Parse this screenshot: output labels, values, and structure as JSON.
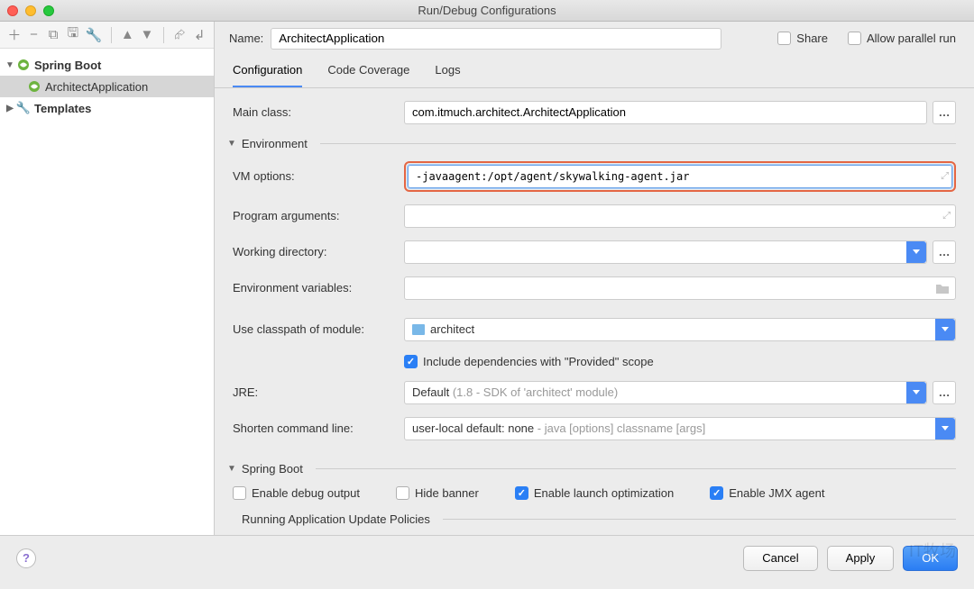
{
  "window": {
    "title": "Run/Debug Configurations"
  },
  "toolbar_icons": [
    "+",
    "−",
    "❐",
    "▤",
    "🔧",
    "▲",
    "▼",
    "⮓",
    "↲"
  ],
  "sidebar": {
    "items": [
      {
        "label": "Spring Boot",
        "level": 0,
        "expanded": true,
        "icon": "spring"
      },
      {
        "label": "ArchitectApplication",
        "level": 1,
        "selected": true,
        "icon": "spring"
      },
      {
        "label": "Templates",
        "level": 0,
        "expanded": false,
        "icon": "wrench"
      }
    ]
  },
  "header": {
    "name_label": "Name:",
    "name_value": "ArchitectApplication",
    "share_label": "Share",
    "allow_parallel_label": "Allow parallel run"
  },
  "tabs": [
    {
      "label": "Configuration",
      "active": true
    },
    {
      "label": "Code Coverage",
      "active": false
    },
    {
      "label": "Logs",
      "active": false
    }
  ],
  "form": {
    "main_class_label": "Main class:",
    "main_class_value": "com.itmuch.architect.ArchitectApplication",
    "env_group_label": "Environment",
    "vm_options_label": "VM options:",
    "vm_options_value": "-javaagent:/opt/agent/skywalking-agent.jar",
    "program_args_label": "Program arguments:",
    "program_args_value": "",
    "working_dir_label": "Working directory:",
    "working_dir_value": "",
    "env_vars_label": "Environment variables:",
    "env_vars_value": "",
    "classpath_label": "Use classpath of module:",
    "classpath_value": "architect",
    "include_provided_label": "Include dependencies with \"Provided\" scope",
    "jre_label": "JRE:",
    "jre_value_prefix": "Default",
    "jre_value_dim": " (1.8 - SDK of 'architect' module)",
    "shorten_label": "Shorten command line:",
    "shorten_value_prefix": "user-local default: none",
    "shorten_value_dim": " - java [options] classname [args]",
    "spring_group_label": "Spring Boot",
    "enable_debug_label": "Enable debug output",
    "hide_banner_label": "Hide banner",
    "enable_launch_opt_label": "Enable launch optimization",
    "enable_jmx_label": "Enable JMX agent",
    "update_policies_label": "Running Application Update Policies"
  },
  "footer": {
    "cancel": "Cancel",
    "apply": "Apply",
    "ok": "OK"
  },
  "watermark": "IT牧场"
}
